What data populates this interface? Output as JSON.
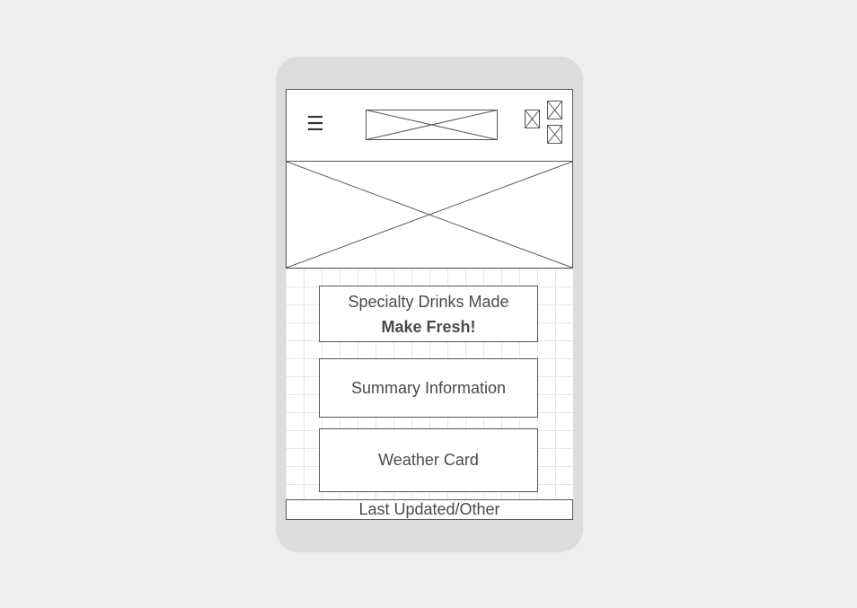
{
  "header": {
    "menu_icon": "☰",
    "menu_icon_name": "hamburger-menu-icon",
    "logo_placeholder_name": "logo-image-placeholder",
    "action_icon_names": [
      "action-icon-placeholder",
      "action-icon-placeholder",
      "action-icon-placeholder"
    ]
  },
  "hero": {
    "image_placeholder_name": "hero-image-placeholder"
  },
  "cards": {
    "specialty": {
      "title": "Specialty Drinks Made",
      "subtitle": "Make Fresh!"
    },
    "summary": {
      "title": "Summary Information"
    },
    "weather": {
      "title": "Weather Card"
    }
  },
  "footer": {
    "text": "Last Updated/Other"
  },
  "colors": {
    "page_background": "#eeeeee",
    "device_frame": "#dcdcdc",
    "wire_stroke": "#555555",
    "grid_line": "#e6e6e6",
    "text": "#4a4a4a"
  }
}
